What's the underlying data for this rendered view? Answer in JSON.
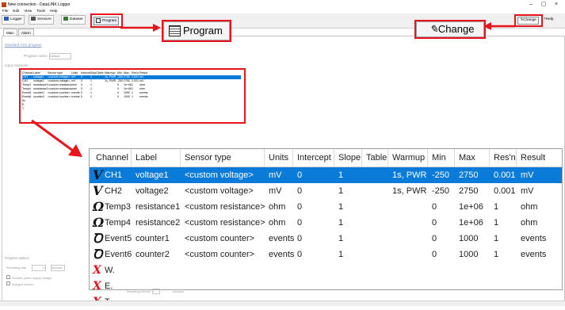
{
  "window": {
    "title": "New connection - DataLINK Logger",
    "minimize": "–",
    "maximize": "▢",
    "close": "×"
  },
  "menu": [
    "File",
    "Edit",
    "View",
    "Tools",
    "Help"
  ],
  "toolbar": {
    "logger": "Logger",
    "sensors": "Sensors",
    "dataset": "Dataset",
    "program": "Program",
    "change": "Change",
    "help": "Help"
  },
  "tabs": {
    "main": "Main",
    "alarm": "Alarm"
  },
  "program_section": {
    "heading": "Standard CH1 program",
    "name_label": "Program name",
    "name_value": "Default"
  },
  "channels_label": "Input channels",
  "callouts": {
    "program": "Program",
    "change": "Change"
  },
  "columns": [
    "Channel",
    "Label",
    "Sensor type",
    "Units",
    "Intercept",
    "Slope",
    "Table",
    "Warmup",
    "Min",
    "Max",
    "Res'n",
    "Result"
  ],
  "rows": [
    {
      "icon": "voltage",
      "symbol": "V",
      "channel": "CH1",
      "label": "voltage1",
      "sensor": "<custom voltage>",
      "units": "mV",
      "intercept": "0",
      "slope": "1",
      "table": "",
      "warmup": "1s, PWR",
      "min": "-250",
      "max": "2750",
      "resn": "0.001",
      "result": "mV"
    },
    {
      "icon": "voltage",
      "symbol": "V",
      "channel": "CH2",
      "label": "voltage2",
      "sensor": "<custom voltage>",
      "units": "mV",
      "intercept": "0",
      "slope": "1",
      "table": "",
      "warmup": "1s, PWR",
      "min": "-250",
      "max": "2750",
      "resn": "0.001",
      "result": "mV"
    },
    {
      "icon": "resistance",
      "symbol": "Ω",
      "channel": "Temp3",
      "label": "resistance1",
      "sensor": "<custom resistance>",
      "units": "ohm",
      "intercept": "0",
      "slope": "1",
      "table": "",
      "warmup": "",
      "min": "0",
      "max": "1e+06",
      "resn": "1",
      "result": "ohm"
    },
    {
      "icon": "resistance",
      "symbol": "Ω",
      "channel": "Temp4",
      "label": "resistance2",
      "sensor": "<custom resistance>",
      "units": "ohm",
      "intercept": "0",
      "slope": "1",
      "table": "",
      "warmup": "",
      "min": "0",
      "max": "1e+06",
      "resn": "1",
      "result": "ohm"
    },
    {
      "icon": "counter",
      "symbol": "Ꝺ",
      "channel": "Event5",
      "label": "counter1",
      "sensor": "<custom counter>",
      "units": "events",
      "intercept": "0",
      "slope": "1",
      "table": "",
      "warmup": "",
      "min": "0",
      "max": "1000",
      "resn": "1",
      "result": "events"
    },
    {
      "icon": "counter",
      "symbol": "Ꝺ",
      "channel": "Event6",
      "label": "counter2",
      "sensor": "<custom counter>",
      "units": "events",
      "intercept": "0",
      "slope": "1",
      "table": "",
      "warmup": "",
      "min": "0",
      "max": "1000",
      "resn": "1",
      "result": "events"
    },
    {
      "icon": "disabled",
      "symbol": "X",
      "channel": "W.",
      "label": "",
      "sensor": "",
      "units": "",
      "intercept": "",
      "slope": "",
      "table": "",
      "warmup": "",
      "min": "",
      "max": "",
      "resn": "",
      "result": ""
    },
    {
      "icon": "disabled",
      "symbol": "X",
      "channel": "E.",
      "label": "",
      "sensor": "",
      "units": "",
      "intercept": "",
      "slope": "",
      "table": "",
      "warmup": "",
      "min": "",
      "max": "",
      "resn": "",
      "result": ""
    },
    {
      "icon": "disabled",
      "symbol": "X",
      "channel": "T.",
      "label": "",
      "sensor": "",
      "units": "",
      "intercept": "",
      "slope": "",
      "table": "",
      "warmup": "",
      "min": "",
      "max": "",
      "resn": "",
      "result": ""
    }
  ],
  "program_options": {
    "heading": "Program options",
    "logging_rate_label": "Recording rate",
    "logging_rate_value": "10",
    "logging_rate_unit": "seconds",
    "opt1": "Exclude power supply voltage",
    "opt2": "Autogrid column",
    "timing_label": "Reporting interval",
    "timing_value": "1",
    "timing_unit": "seconds"
  },
  "colors": {
    "accent": "#0a7bd8",
    "callout": "#e8141c"
  }
}
